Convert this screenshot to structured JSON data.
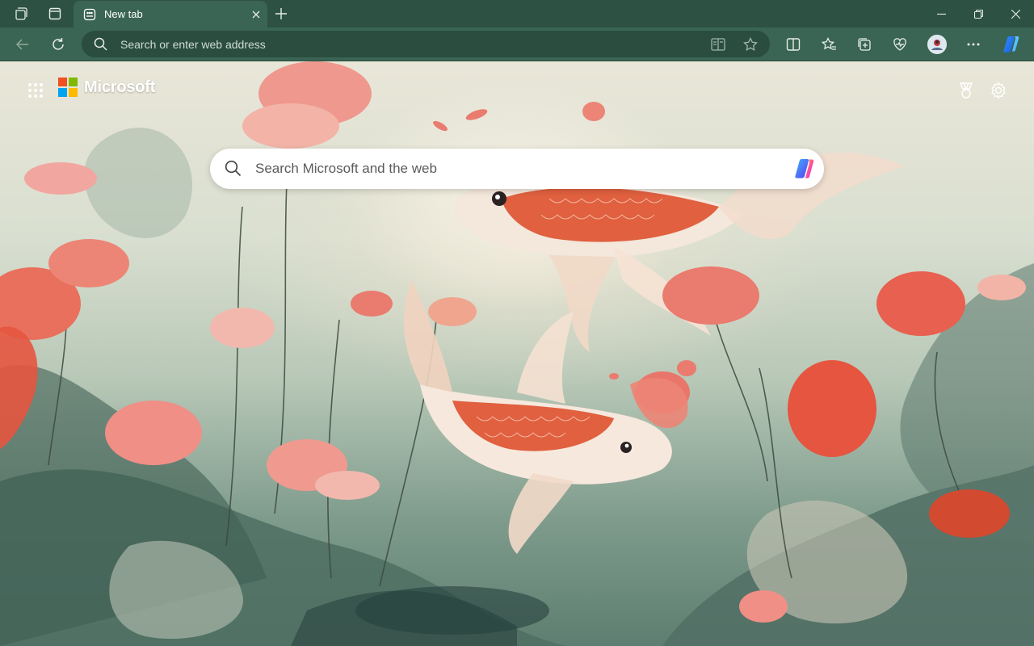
{
  "window": {
    "tab": {
      "title": "New tab",
      "icon": "new-tab-page-icon"
    },
    "controls": {
      "minimize": "minimize-icon",
      "restore": "restore-icon",
      "close": "close-icon"
    }
  },
  "toolbar": {
    "address_placeholder": "Search or enter web address",
    "icons": [
      "back-icon",
      "refresh-icon",
      "immersive-reader-icon",
      "favorite-star-icon",
      "split-screen-icon",
      "favorites-icon",
      "collections-icon",
      "browser-essentials-icon",
      "profile-avatar",
      "more-icon",
      "copilot-icon"
    ]
  },
  "page": {
    "brand": "Microsoft",
    "search_placeholder": "Search Microsoft and the web",
    "icons": [
      "apps-launcher-icon",
      "rewards-icon",
      "settings-gear-icon",
      "copilot-icon"
    ]
  },
  "colors": {
    "titlebar": "#2d5143",
    "toolbar": "#3a6453",
    "address_bar": "#2b4d3f",
    "ms_red": "#f25022",
    "ms_green": "#7fba00",
    "ms_blue": "#00a4ef",
    "ms_yellow": "#ffb900",
    "koi_orange": "#e0603f",
    "flower_pink": "#ef8f86"
  }
}
